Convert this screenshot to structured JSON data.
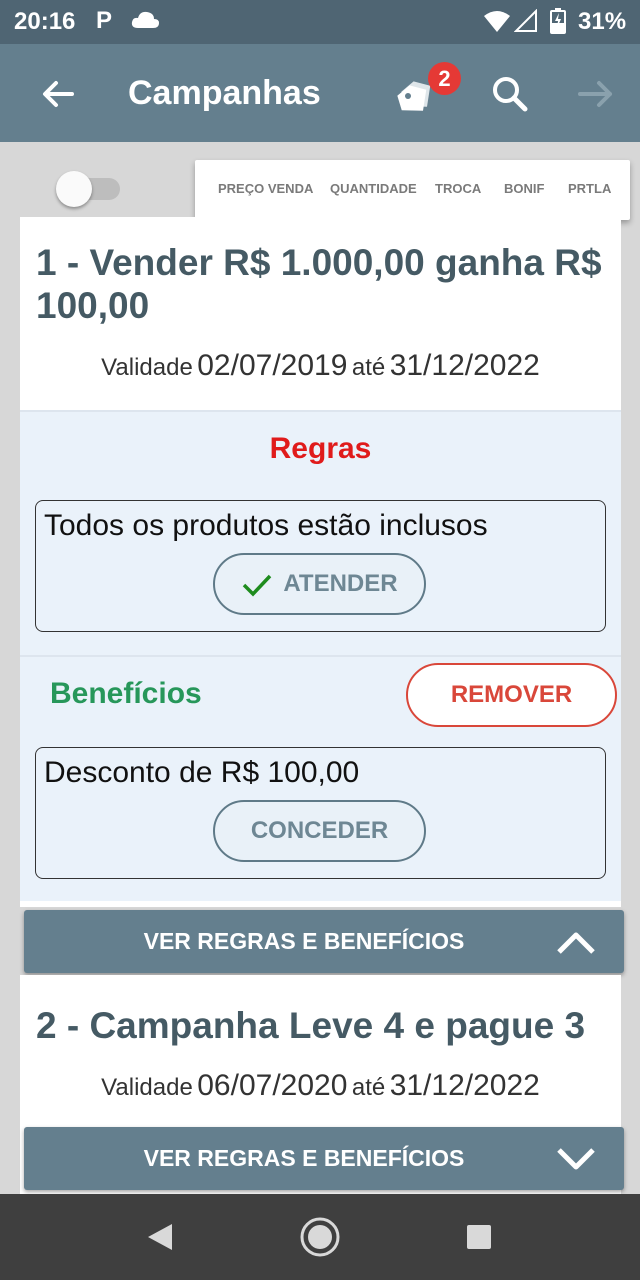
{
  "status_bar": {
    "time": "20:16",
    "app_letter": "P",
    "battery": "31%"
  },
  "app_bar": {
    "title": "Campanhas",
    "badge_count": "2",
    "icons": [
      "arrow-left-icon",
      "tags-icon",
      "search-icon",
      "arrow-right-icon"
    ]
  },
  "tabs": [
    "PREÇO VENDA",
    "QUANTIDADE",
    "TROCA",
    "BONIF",
    "PRTLA"
  ],
  "campaign1": {
    "title": "1 - Vender R$ 1.000,00 ganha R$ 100,00",
    "validity_label": "Validade",
    "validity_from": "02/07/2019",
    "validity_sep": "até",
    "validity_to": "31/12/2022",
    "rules_title": "Regras",
    "rule_text": "Todos os produtos estão inclusos",
    "rule_button": "ATENDER",
    "benefits_title": "Benefícios",
    "remove_button": "REMOVER",
    "benefit_text": "Desconto de R$ 100,00",
    "benefit_button": "CONCEDER",
    "expander_label": "VER REGRAS E BENEFÍCIOS"
  },
  "campaign2": {
    "title": "2 - Campanha Leve 4 e pague 3",
    "validity_label": "Validade",
    "validity_from": "06/07/2020",
    "validity_sep": "até",
    "validity_to": "31/12/2022",
    "expander_label": "VER REGRAS E BENEFÍCIOS"
  },
  "colors": {
    "status_bar": "#4f6573",
    "app_bar": "#647f8e",
    "rules_title": "#e01b1b",
    "benefits_title": "#27975a",
    "remove": "#d9473a",
    "heading": "#455a64"
  }
}
